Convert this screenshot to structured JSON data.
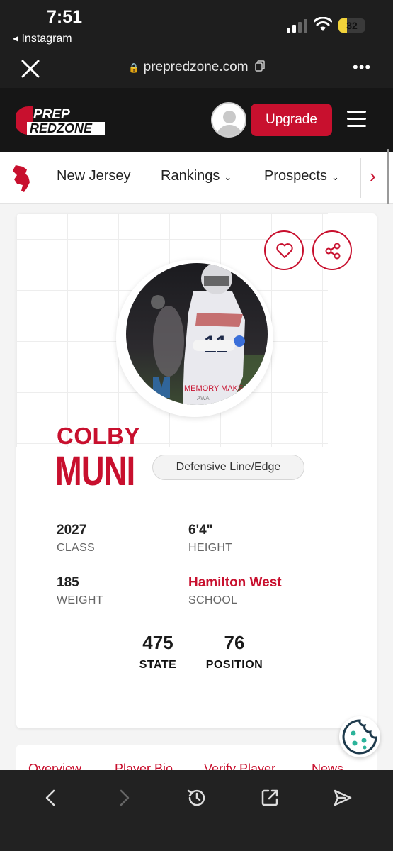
{
  "status_bar": {
    "time": "7:51",
    "back_app": "◂ Instagram",
    "battery_level": "32",
    "battery_fraction": 0.32
  },
  "browser": {
    "url": "prepredzone.com"
  },
  "site": {
    "logo_top": "PREP",
    "logo_bottom": "REDZONE",
    "upgrade_label": "Upgrade"
  },
  "nav": {
    "items": [
      {
        "label": "New Jersey"
      },
      {
        "label": "Rankings"
      },
      {
        "label": "Prospects"
      }
    ]
  },
  "player": {
    "first_name": "COLBY",
    "last_name": "MUNI",
    "position": "Defensive Line/Edge",
    "photo_watermark": "MEMORY MAKE",
    "photo_watermark_sub": "AWA",
    "stats": {
      "class_value": "2027",
      "class_label": "CLASS",
      "height_value": "6'4\"",
      "height_label": "HEIGHT",
      "weight_value": "185",
      "weight_label": "WEIGHT",
      "school_value": "Hamilton West",
      "school_label": "SCHOOL"
    },
    "rankings": {
      "state_value": "475",
      "state_label": "STATE",
      "position_value": "76",
      "position_label": "POSITION"
    }
  },
  "tabs": [
    "Overview",
    "Player Bio",
    "Verify Player",
    "News"
  ],
  "colors": {
    "brand_red": "#c8102e",
    "header_bg": "#161616",
    "toolbar_bg": "#222222"
  },
  "icons": [
    "signal-icon",
    "wifi-icon",
    "close-icon",
    "lock-icon",
    "copy-icon",
    "more-icon",
    "avatar-icon",
    "menu-icon",
    "new-jersey-icon",
    "chevron-right-icon",
    "heart-icon",
    "share-icon",
    "cookie-icon",
    "back-icon",
    "forward-icon",
    "history-icon",
    "open-external-icon",
    "send-icon"
  ]
}
